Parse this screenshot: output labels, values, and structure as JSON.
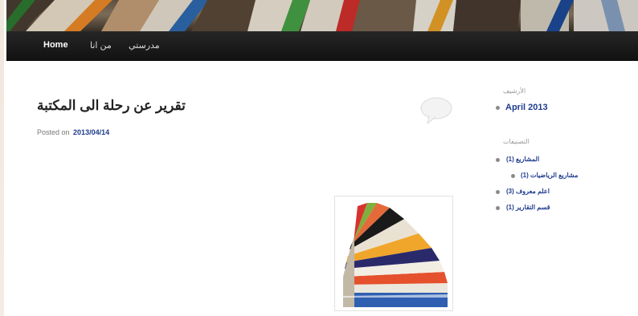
{
  "nav": {
    "home": "Home",
    "about": "من انا",
    "school": "مدرستي"
  },
  "post": {
    "title": "تقرير عن رحلة الى المكتبة",
    "posted_on": "Posted on",
    "date": "2013/04/14"
  },
  "sidebar": {
    "archives_title": "الأرشيف",
    "archives": [
      "April 2013"
    ],
    "categories_title": "التصنيفات",
    "categories": [
      "المشاريع (1)",
      "مشاريع الرياضيات (1)",
      "اعلم معروف (3)",
      "قسم التقارير (1)"
    ]
  },
  "colors": {
    "nav_bg": "#161616",
    "link": "#1e3b8f",
    "title": "#222222"
  }
}
